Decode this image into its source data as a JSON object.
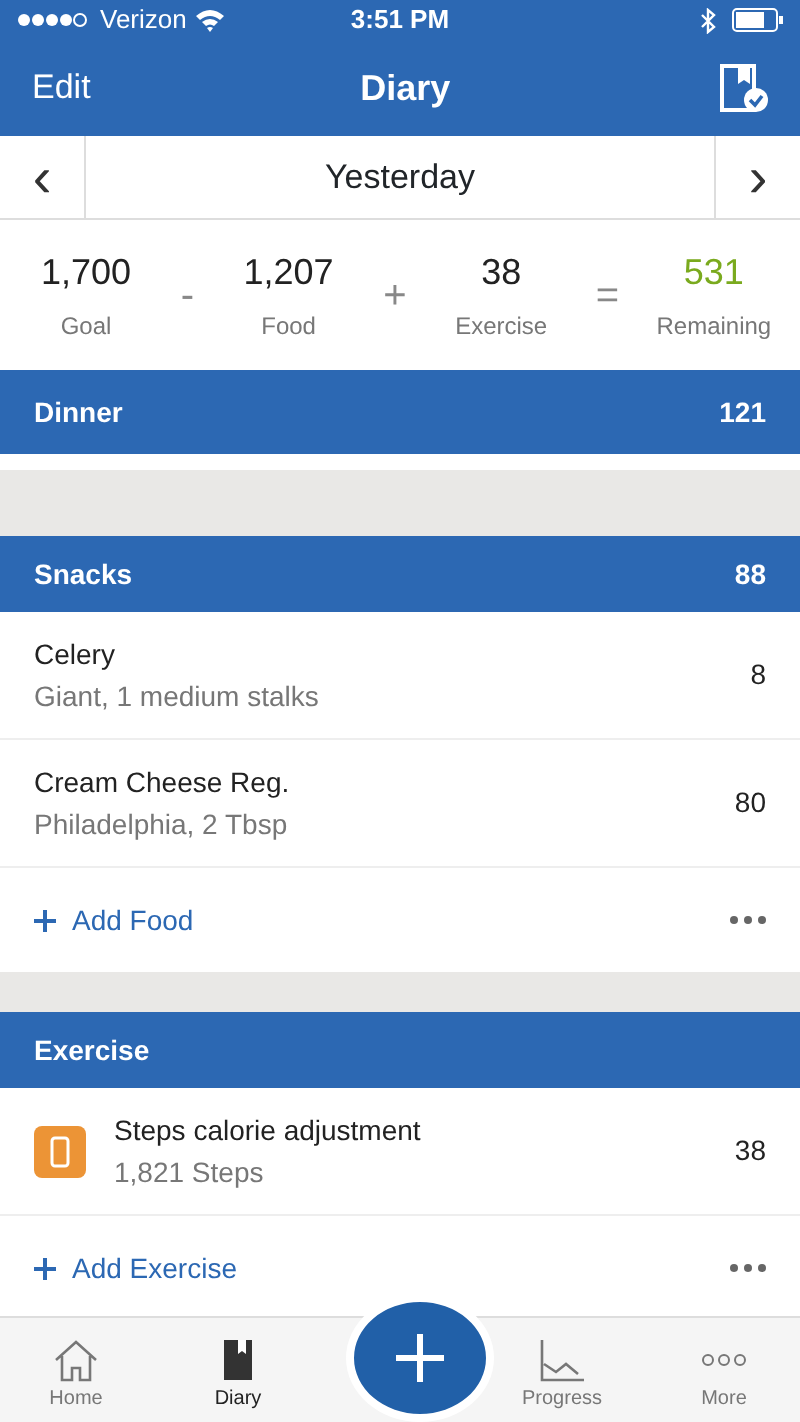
{
  "status_bar": {
    "carrier": "Verizon",
    "time": "3:51 PM"
  },
  "nav": {
    "left": "Edit",
    "title": "Diary"
  },
  "date_bar": {
    "prev": "‹",
    "label": "Yesterday",
    "next": "›"
  },
  "summary": [
    {
      "value": "1,700",
      "label": "Goal",
      "op": "-"
    },
    {
      "value": "1,207",
      "label": "Food",
      "op": "+"
    },
    {
      "value": "38",
      "label": "Exercise",
      "op": "="
    },
    {
      "value": "531",
      "label": "Remaining",
      "highlight": true
    }
  ],
  "sections": [
    {
      "name": "Dinner",
      "calories": "121"
    },
    {
      "name": "Snacks",
      "calories": "88",
      "items": [
        {
          "name": "Celery",
          "detail": "Giant, 1 medium stalks",
          "calories": "8"
        },
        {
          "name": "Cream Cheese Reg.",
          "detail": "Philadelphia, 2 Tbsp",
          "calories": "80"
        }
      ],
      "add_label": "Add Food"
    },
    {
      "name": "Exercise",
      "items": [
        {
          "name": "Steps calorie adjustment",
          "detail": "1,821 Steps",
          "calories": "38",
          "kind": "steps"
        }
      ],
      "add_label": "Add Exercise"
    }
  ],
  "tab_bar": [
    {
      "label": "Home",
      "kind": "home",
      "selected": false
    },
    {
      "label": "Diary",
      "kind": "diary",
      "selected": true
    },
    {
      "kind": "add"
    },
    {
      "label": "Progress",
      "kind": "progress",
      "selected": false
    },
    {
      "label": "More",
      "kind": "more",
      "selected": false
    }
  ]
}
